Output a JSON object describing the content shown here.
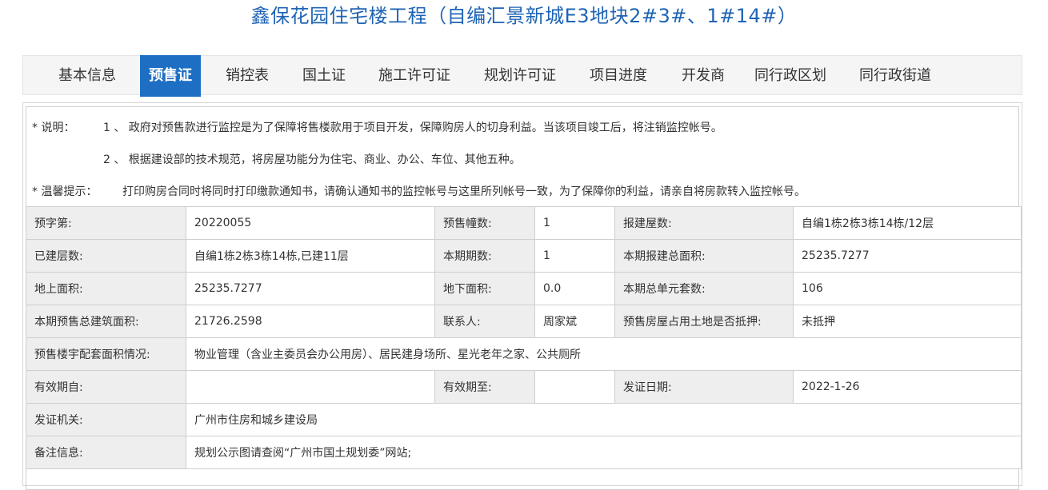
{
  "header": {
    "title": "鑫保花园住宅楼工程（自编汇景新城E3地块2#3#、1#14#）"
  },
  "tabs": [
    {
      "label": "基本信息",
      "active": false
    },
    {
      "label": "预售证",
      "active": true
    },
    {
      "label": "销控表",
      "active": false
    },
    {
      "label": "国土证",
      "active": false
    },
    {
      "label": "施工许可证",
      "active": false
    },
    {
      "label": "规划许可证",
      "active": false
    },
    {
      "label": "项目进度",
      "active": false
    },
    {
      "label": "开发商",
      "active": false
    },
    {
      "label": "同行政区划",
      "active": false
    },
    {
      "label": "同行政街道",
      "active": false
    }
  ],
  "notes": {
    "explain_label": "* 说明：",
    "item1": "1 、 政府对预售款进行监控是为了保障将售楼款用于项目开发，保障购房人的切身利益。当该项目竣工后，将注销监控帐号。",
    "item2": "2 、 根据建设部的技术规范，将房屋功能分为住宅、商业、办公、车位、其他五种。",
    "tip_label": "* 温馨提示：",
    "tip": "打印购房合同时将同时打印缴款通知书，请确认通知书的监控帐号与这里所列帐号一致，为了保障你的利益，请亲自将房款转入监控帐号。"
  },
  "info": {
    "r1": {
      "l1": "预字第:",
      "v1": "20220055",
      "l2": "预售幢数:",
      "v2": "1",
      "l3": "报建屋数:",
      "v3": "自编1栋2栋3栋14栋/12层"
    },
    "r2": {
      "l1": "已建层数:",
      "v1": "自编1栋2栋3栋14栋,已建11层",
      "l2": "本期期数:",
      "v2": "1",
      "l3": "本期报建总面积:",
      "v3": "25235.7277"
    },
    "r3": {
      "l1": "地上面积:",
      "v1": "25235.7277",
      "l2": "地下面积:",
      "v2": "0.0",
      "l3": "本期总单元套数:",
      "v3": "106"
    },
    "r4": {
      "l1": "本期预售总建筑面积:",
      "v1": "21726.2598",
      "l2": "联系人:",
      "v2": "周家斌",
      "l3": "预售房屋占用土地是否抵押:",
      "v3": "未抵押"
    },
    "r5": {
      "l1": "预售楼宇配套面积情况:",
      "v1": "物业管理（含业主委员会办公用房）、居民建身场所、星光老年之家、公共厕所"
    },
    "r6": {
      "l1": "有效期自:",
      "v1": "",
      "l2": "有效期至:",
      "v2": "",
      "l3": "发证日期:",
      "v3": "2022-1-26"
    },
    "r7": {
      "l1": "发证机关:",
      "v1": "广州市住房和城乡建设局"
    },
    "r8": {
      "l1": "备注信息:",
      "v1": "规划公示图请查阅“广州市国土规划委”网站;"
    }
  },
  "colors": {
    "accent": "#1e6fc4",
    "title": "#1f64b4",
    "note_label": "#d82b2b",
    "label_bg": "#eeeeee"
  }
}
